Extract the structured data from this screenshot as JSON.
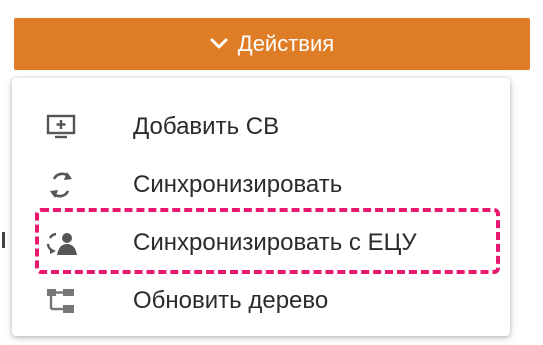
{
  "actions_button": {
    "label": "Действия",
    "icon": "chevron-down-icon",
    "color": "#df7d26"
  },
  "menu": {
    "items": [
      {
        "label": "Добавить СВ",
        "icon": "add-vm-icon"
      },
      {
        "label": "Синхронизировать",
        "icon": "sync-icon"
      },
      {
        "label": "Синхронизировать с ЕЦУ",
        "icon": "sync-with-ecu-icon",
        "highlighted": true
      },
      {
        "label": "Обновить дерево",
        "icon": "refresh-tree-icon"
      }
    ]
  },
  "highlight_color": "#e8186e"
}
